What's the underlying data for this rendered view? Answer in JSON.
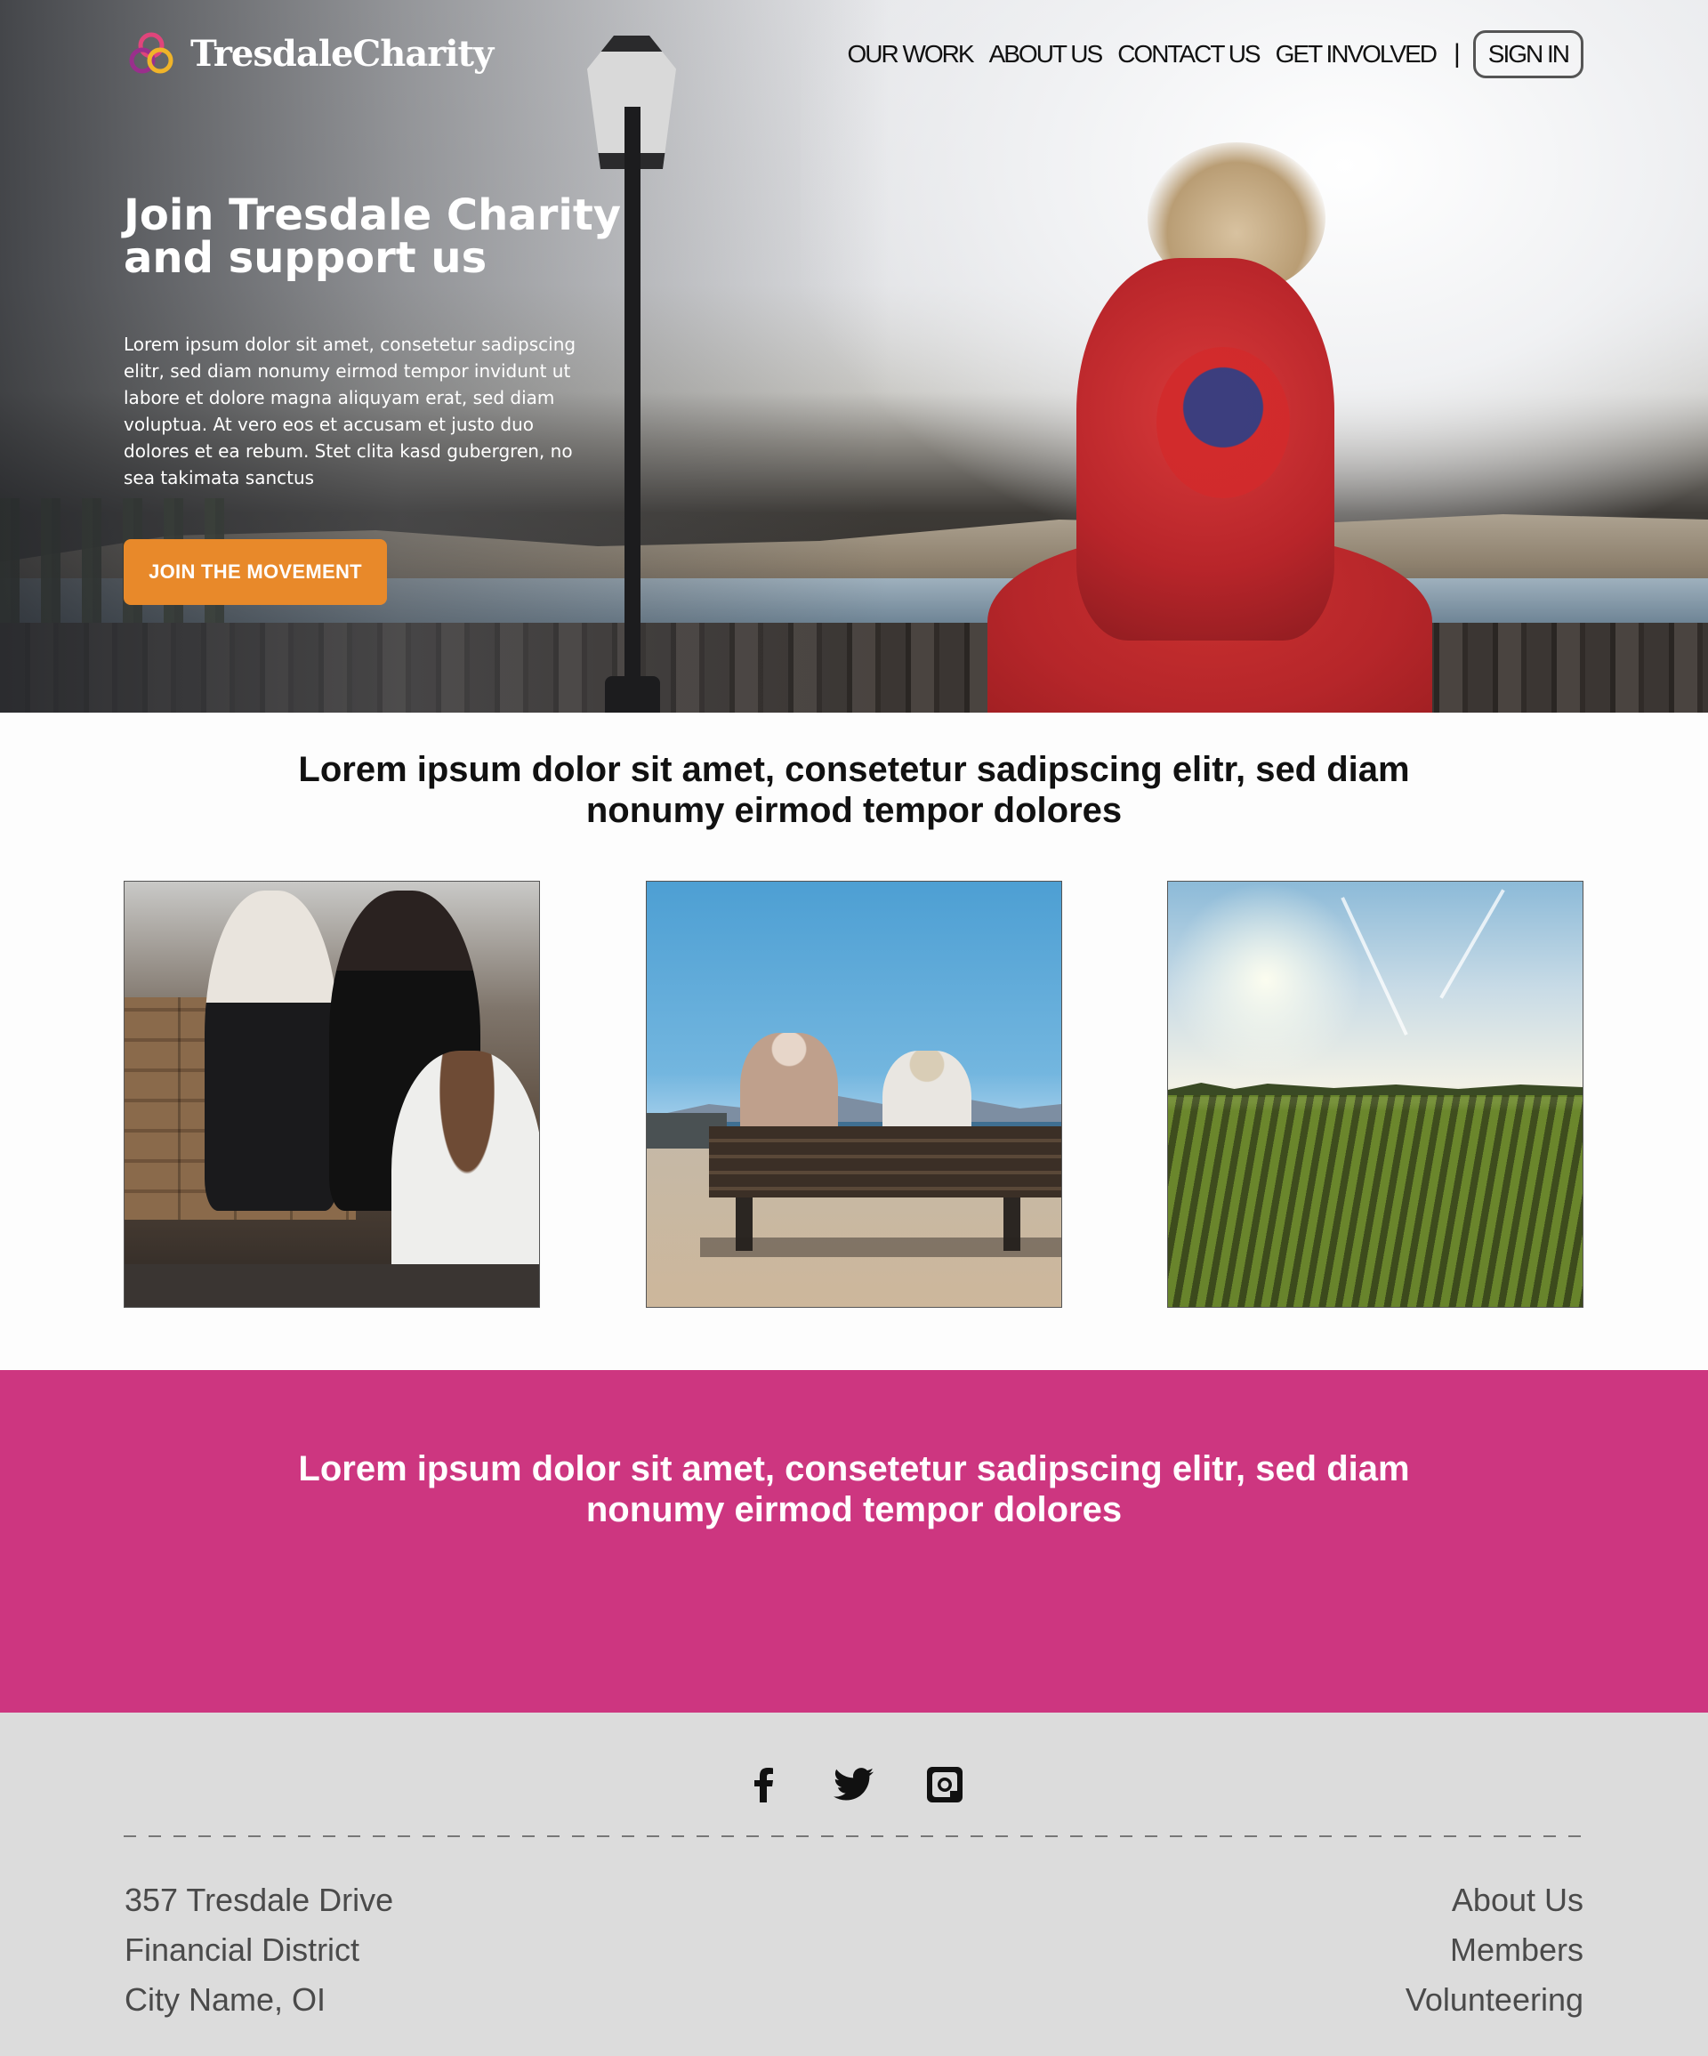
{
  "brand": {
    "name": "TresdaleCharity"
  },
  "nav": {
    "items": [
      "OUR WORK",
      "ABOUT US",
      "CONTACT US",
      "GET INVOLVED"
    ],
    "separator": "|",
    "signin": "SIGN IN"
  },
  "hero": {
    "title": "Join Tresdale Charity and support us",
    "body": "Lorem ipsum dolor sit amet, consetetur sadipscing elitr, sed diam nonumy eirmod tempor invidunt ut labore et dolore magna aliquyam erat, sed diam voluptua. At vero eos et accusam et justo duo dolores et ea rebum. Stet clita kasd gubergren, no sea takimata sanctus",
    "cta": "JOIN THE MOVEMENT"
  },
  "section2": {
    "title": "Lorem ipsum dolor sit amet, consetetur sadipscing elitr, sed diam nonumy eirmod tempor dolores"
  },
  "band": {
    "title": "Lorem ipsum dolor sit amet, consetetur sadipscing elitr, sed diam nonumy eirmod tempor dolores"
  },
  "footer": {
    "social": [
      "facebook-icon",
      "twitter-icon",
      "instagram-icon"
    ],
    "address": [
      "357 Tresdale Drive",
      "Financial District",
      "City Name, OI"
    ],
    "links": [
      "About Us",
      "Members",
      "Volunteering"
    ]
  },
  "colors": {
    "accent_orange": "#e8892a",
    "band_pink": "#cd3680",
    "footer_gray": "#dcdcdc"
  }
}
